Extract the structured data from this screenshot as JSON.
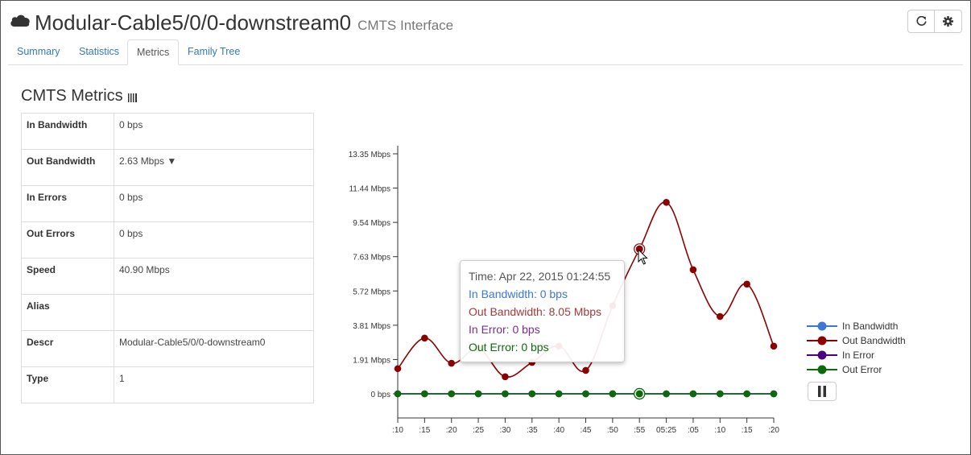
{
  "header": {
    "title": "Modular-Cable5/0/0-downstream0",
    "subtitle": "CMTS Interface",
    "refresh_icon": "refresh-icon",
    "settings_icon": "gear-icon"
  },
  "tabs": [
    {
      "label": "Summary",
      "active": false
    },
    {
      "label": "Statistics",
      "active": false
    },
    {
      "label": "Metrics",
      "active": true
    },
    {
      "label": "Family Tree",
      "active": false
    }
  ],
  "section": {
    "title": "CMTS Metrics"
  },
  "metrics": [
    {
      "key": "In Bandwidth",
      "value": "0 bps"
    },
    {
      "key": "Out Bandwidth",
      "value": "2.63 Mbps ▼"
    },
    {
      "key": "In Errors",
      "value": "0 bps"
    },
    {
      "key": "Out Errors",
      "value": "0 bps"
    },
    {
      "key": "Speed",
      "value": "40.90 Mbps"
    },
    {
      "key": "Alias",
      "value": ""
    },
    {
      "key": "Descr",
      "value": "Modular-Cable5/0/0-downstream0"
    },
    {
      "key": "Type",
      "value": "1"
    }
  ],
  "tooltip": {
    "time": "Time: Apr 22, 2015 01:24:55",
    "in_bandwidth": "In Bandwidth: 0 bps",
    "out_bandwidth": "Out Bandwidth: 8.05 Mbps",
    "in_error": "In Error: 0 bps",
    "out_error": "Out Error: 0 bps"
  },
  "legend": [
    {
      "name": "In Bandwidth",
      "color": "#3a78d4"
    },
    {
      "name": "Out Bandwidth",
      "color": "#8b0000"
    },
    {
      "name": "In Error",
      "color": "#4b0082"
    },
    {
      "name": "Out Error",
      "color": "#0b6b0b"
    }
  ],
  "chart_data": {
    "type": "line",
    "x": [
      ":10",
      ":15",
      ":20",
      ":25",
      ":30",
      ":35",
      ":40",
      ":45",
      ":50",
      ":55",
      "05:25",
      ":05",
      ":10",
      ":15",
      ":20"
    ],
    "y_ticks": [
      "0 bps",
      "1.91 Mbps",
      "3.81 Mbps",
      "5.72 Mbps",
      "7.63 Mbps",
      "9.54 Mbps",
      "11.44 Mbps",
      "13.35 Mbps"
    ],
    "ylim": [
      0,
      13.35
    ],
    "y_unit": "Mbps",
    "series": [
      {
        "name": "In Bandwidth",
        "color": "#3a78d4",
        "values": [
          0,
          0,
          0,
          0,
          0,
          0,
          0,
          0,
          0,
          0,
          0,
          0,
          0,
          0,
          0
        ]
      },
      {
        "name": "Out Bandwidth",
        "color": "#8b0000",
        "values": [
          1.4,
          3.1,
          1.7,
          2.5,
          0.95,
          1.75,
          2.65,
          1.3,
          4.9,
          8.05,
          10.65,
          6.9,
          4.3,
          6.1,
          2.65
        ]
      },
      {
        "name": "In Error",
        "color": "#4b0082",
        "values": [
          0,
          0,
          0,
          0,
          0,
          0,
          0,
          0,
          0,
          0,
          0,
          0,
          0,
          0,
          0
        ]
      },
      {
        "name": "Out Error",
        "color": "#0b6b0b",
        "values": [
          0,
          0,
          0,
          0,
          0,
          0,
          0,
          0,
          0,
          0,
          0,
          0,
          0,
          0,
          0
        ]
      }
    ],
    "highlight_index": 9
  }
}
